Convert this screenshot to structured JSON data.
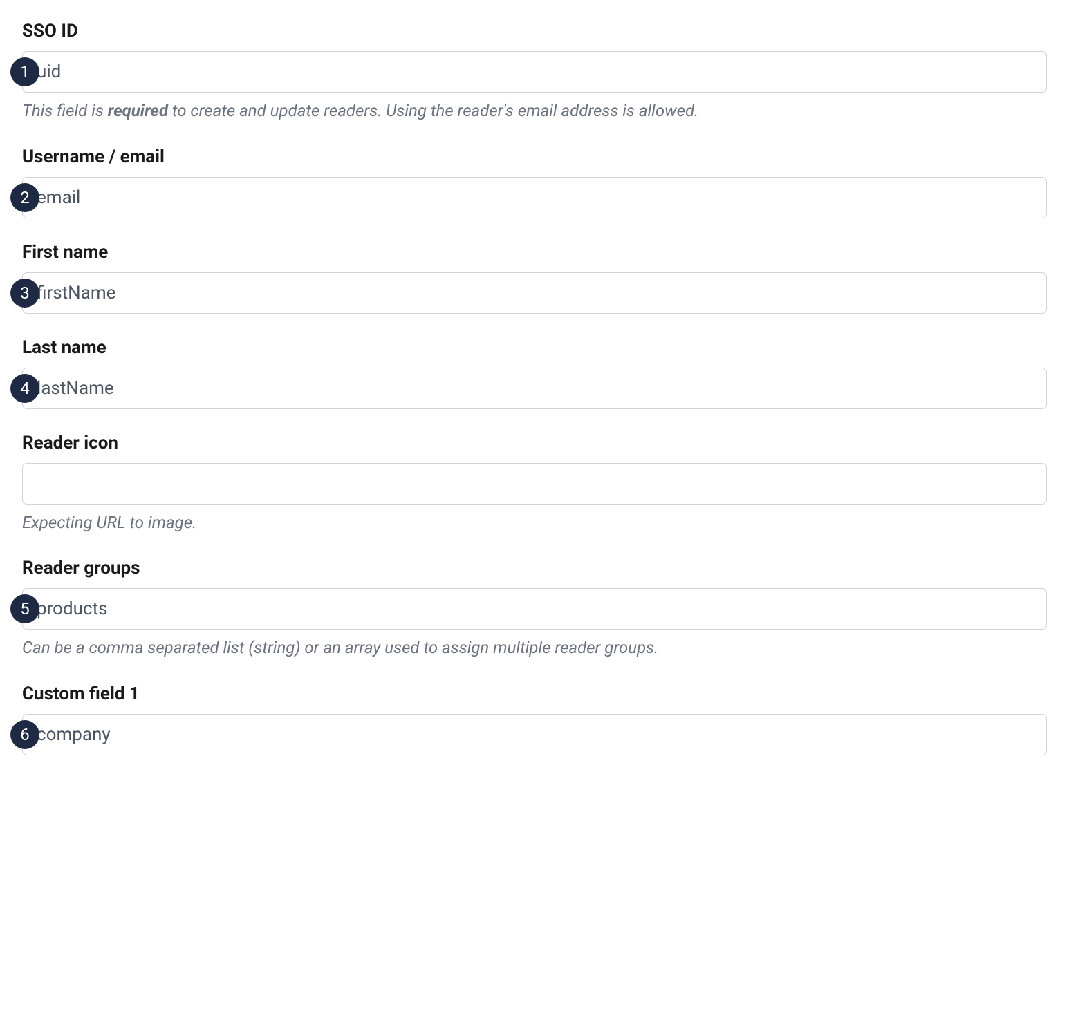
{
  "fields": [
    {
      "label": "SSO ID",
      "value": "uid",
      "badge": "1",
      "help_pre": "This field is ",
      "help_strong": "required",
      "help_post": " to create and update readers. Using the reader's email address is allowed."
    },
    {
      "label": "Username / email",
      "value": "email",
      "badge": "2"
    },
    {
      "label": "First name",
      "value": "firstName",
      "badge": "3"
    },
    {
      "label": "Last name",
      "value": "lastName",
      "badge": "4"
    },
    {
      "label": "Reader icon",
      "value": "",
      "help": "Expecting URL to image."
    },
    {
      "label": "Reader groups",
      "value": "products",
      "badge": "5",
      "help": "Can be a comma separated list (string) or an array used to assign multiple reader groups."
    },
    {
      "label": "Custom field 1",
      "value": "company",
      "badge": "6"
    }
  ]
}
